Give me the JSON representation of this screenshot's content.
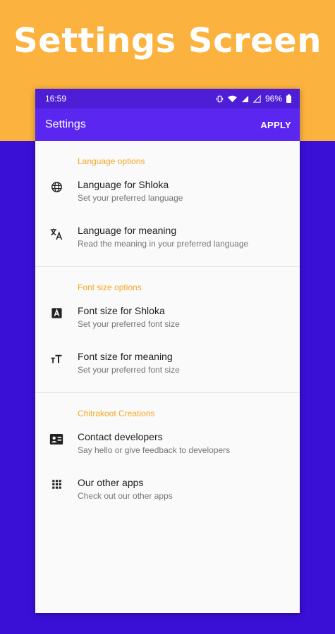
{
  "banner": {
    "title": "Settings Screen"
  },
  "status_bar": {
    "time": "16:59",
    "battery": "96%"
  },
  "app_bar": {
    "title": "Settings",
    "apply_label": "APPLY"
  },
  "sections": [
    {
      "header": "Language options",
      "items": [
        {
          "icon": "globe-icon",
          "title": "Language for Shloka",
          "subtitle": "Set your preferred language"
        },
        {
          "icon": "translate-icon",
          "title": "Language for meaning",
          "subtitle": "Read the meaning in your preferred language"
        }
      ]
    },
    {
      "header": "Font size options",
      "items": [
        {
          "icon": "font-box-icon",
          "title": "Font size for Shloka",
          "subtitle": "Set your preferred font size"
        },
        {
          "icon": "text-size-icon",
          "title": "Font size for meaning",
          "subtitle": "Set your preferred font size"
        }
      ]
    },
    {
      "header": "Chitrakoot Creations",
      "items": [
        {
          "icon": "contact-card-icon",
          "title": "Contact developers",
          "subtitle": "Say hello or give feedback to developers"
        },
        {
          "icon": "apps-grid-icon",
          "title": "Our other apps",
          "subtitle": "Check out our other apps"
        }
      ]
    }
  ],
  "colors": {
    "banner_bg": "#fcb23e",
    "page_bg": "#3a0fd6",
    "app_bar": "#5b26f0",
    "status_bar": "#4d1ed6",
    "section_header": "#f5a623"
  }
}
